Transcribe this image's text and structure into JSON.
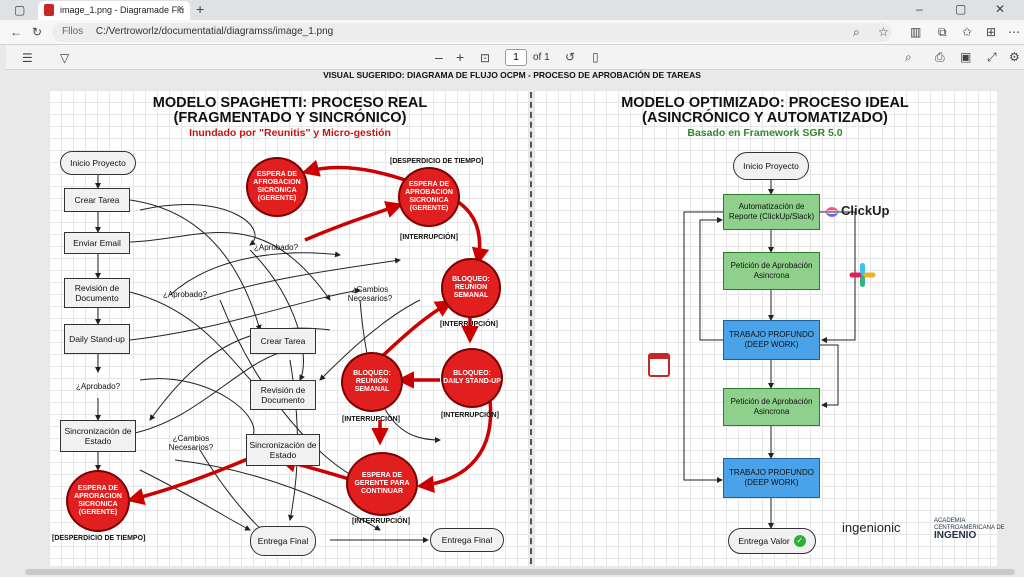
{
  "browser": {
    "tab_title": "image_1.png - Diagramade Flu",
    "url_prefix": "Fllos",
    "url": "C:/Vertroworlz/documentatial/diagramss/image_1.png"
  },
  "pdf_toolbar": {
    "page": "1",
    "of_pages": "of 1"
  },
  "suggested_title": "VISUAL SUGERIDO: DIAGRAMA DE FLUJO OCPM - PROCESO DE APROBACIÓN DE TAREAS",
  "left": {
    "title_line1": "MODELO SPAGHETTI: PROCESO REAL",
    "title_line2": "(FRAGMENTADO Y SINCRÓNICO)",
    "subtitle": "Inundado por \"Reunitis\" y Micro-gestión",
    "boxes": {
      "inicio": "Inicio Proyecto",
      "crear_tarea": "Crear Tarea",
      "enviar_email": "Enviar Email",
      "revision": "Revisión de Documento",
      "daily": "Daily Stand-up",
      "sincronizacion": "Sincronización de Estado",
      "crear_tarea2": "Crear Tarea",
      "revision2": "Revisión de Documento",
      "sincronizacion2": "Sincronización de Estado",
      "entrega_final": "Entrega Final",
      "entrega_final2": "Entrega Final"
    },
    "decisions": {
      "aprobado1": "¿Aprobado?",
      "aprobado2": "¿Aprobado?",
      "aprobado3": "¿Aprobado?",
      "cambios1": "¿Cambios Necesarios?",
      "cambios2": "¿Cambios Necesarios?"
    },
    "red_nodes": {
      "espera1": "ESPERA DE AFROBACION SICRONICA (GERENTE)",
      "espera2": "ESPERA DE APROBACION SICRONICA (GERENTE)",
      "bloqueo1": "BLOQUEO: REUNION SEMANAL",
      "bloqueo2": "BLOQUEO: REUNIÓN SEMANAL",
      "bloqueo3": "BLOQUEO: DAILY STAND-UP",
      "espera_gerente": "ESPERA DE GERENTE PARA CONTINUAR",
      "espera3": "ESPERA DE APRORACION SICRONICA (GERENTE)"
    },
    "tags": {
      "desperdicio1": "[DESPERDICIO DE TIEMPO]",
      "desperdicio2": "[DESPERDICIO DE TIEMPO]",
      "interrupcion1": "[INTERRUPCIÓN]",
      "interrupcion2": "[INTERRUPCIÓN]",
      "interrupcion3": "[INTERRUPCIÓN]",
      "interrupcion4": "[INTERRUPCIÓN]",
      "interrupcion5": "[INTERRUPCIÓN]"
    }
  },
  "right": {
    "title_line1": "MODELO OPTIMIZADO: PROCESO IDEAL",
    "title_line2": "(ASINCRÓNICO Y AUTOMATIZADO)",
    "subtitle": "Basado en Framework SGR 5.0",
    "boxes": {
      "inicio": "Inicio Proyecto",
      "automatizacion": "Automatización de Reporte (ClickUp/Slack)",
      "peticion1": "Petición de Aprobación Asincrona",
      "trabajo1": "TRABAJO PROFUNDO (DEEP WORK)",
      "peticion2": "Petición de Aprobación Asincrona",
      "trabajo2": "TRABAJO PROFUNDO (DEEP WORK)",
      "entrega": "Entrega Valor"
    },
    "clickup_label": "ClickUp",
    "logo_ingenionic": "ingenionic",
    "logo_academia": "ACADEMIA CENTROAMERICANA DE",
    "logo_ingenio": "INGENIO"
  },
  "colors": {
    "red": "#e21f1f",
    "green": "#8fd18c",
    "blue": "#4aa3e8"
  }
}
